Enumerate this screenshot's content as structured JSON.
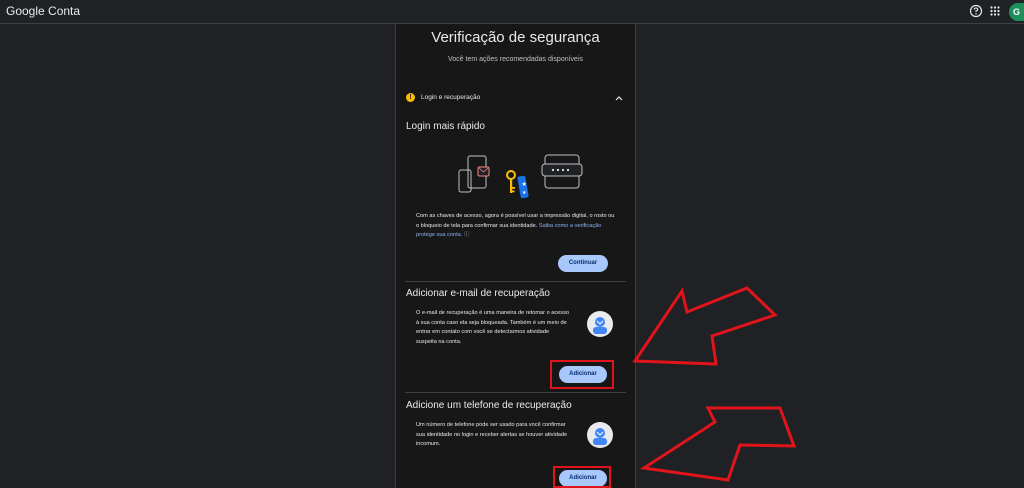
{
  "header": {
    "brand": "Google Conta",
    "avatar_initial": "G",
    "icons": [
      "help-icon",
      "apps-grid-icon"
    ]
  },
  "page": {
    "title": "Verificação de segurança",
    "subtitle": "Você tem ações recomendadas disponíveis"
  },
  "section": {
    "label": "Login e recuperação",
    "status_icon": "warning-icon",
    "warning_color": "#fbbc04"
  },
  "login": {
    "heading": "Login mais rápido",
    "description": "Com as chaves de acesso, agora é possível usar a impressão digital, o rosto ou o bloqueio de tela para confirmar sua identidade.",
    "link": "Saiba como a verificação protege sua conta.",
    "button": "Continuar"
  },
  "email_recovery": {
    "heading": "Adicionar e-mail de recuperação",
    "description": "O e-mail de recuperação é uma maneira de retomar o acesso à sua conta caso ela seja bloqueada. Também é um meio de entrar em contato com você se detectarmos atividade suspeita na conta.",
    "button": "Adicionar"
  },
  "phone_recovery": {
    "heading": "Adicione um telefone de recuperação",
    "description": "Um número de telefone pode ser usado para você confirmar sua identidade no login e receber alertas se houver atividade incomum.",
    "button": "Adicionar"
  },
  "colors": {
    "background": "#202124",
    "panel": "#171717",
    "button": "#a8c7fa",
    "link": "#8ab4f8",
    "annotation": "#e0141b"
  }
}
